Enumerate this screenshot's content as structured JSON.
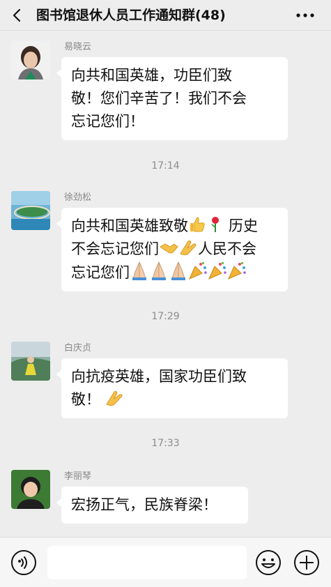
{
  "header": {
    "title": "图书馆退休人员工作通知群(48)",
    "back_icon": "chevron-left-icon",
    "more_icon": "more-dots-icon"
  },
  "messages": [
    {
      "sender": "易晓云",
      "line1": "向共和国英雄，功臣们致",
      "line2": "敬！您们辛苦了！我们不会",
      "line3": "忘记您们！"
    },
    {
      "time": "17:14"
    },
    {
      "sender": "徐劲松",
      "line1": "向共和国英雄致敬",
      "line1b": "历史",
      "line2": "不会忘记您们",
      "line2b": "人民不会",
      "line3": "忘记您们"
    },
    {
      "time": "17:29"
    },
    {
      "sender": "白庆贞",
      "line1": "向抗疫英雄，国家功臣们致",
      "line2": "敬！"
    },
    {
      "time": "17:33"
    },
    {
      "sender": "李丽琴",
      "line1": "宏扬正气，民族脊梁！"
    }
  ],
  "input": {
    "value": ""
  },
  "toolbar": {
    "voice_icon": "voice-icon",
    "emoji_icon": "emoji-icon",
    "plus_icon": "plus-icon"
  },
  "colors": {
    "background": "#ededed",
    "bubble": "#ffffff",
    "name": "#888888"
  }
}
